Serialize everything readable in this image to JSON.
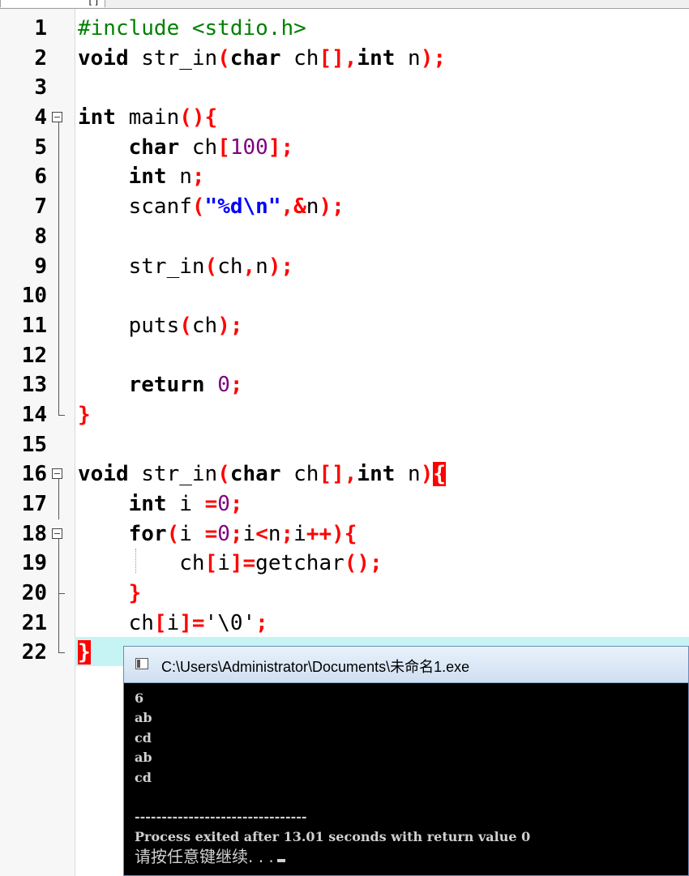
{
  "tab": {
    "label": "[*]"
  },
  "editor": {
    "lines": [
      {
        "n": "1",
        "fold": "none",
        "tokens": [
          [
            "pp",
            "#include <stdio.h>"
          ]
        ]
      },
      {
        "n": "2",
        "fold": "none",
        "tokens": [
          [
            "kw",
            "void"
          ],
          [
            "t",
            " str_in"
          ],
          [
            "p",
            "("
          ],
          [
            "kw",
            "char"
          ],
          [
            "t",
            " ch"
          ],
          [
            "p",
            "[],"
          ],
          [
            "kw",
            "int"
          ],
          [
            "t",
            " n"
          ],
          [
            "p",
            ");"
          ]
        ]
      },
      {
        "n": "3",
        "fold": "none",
        "tokens": []
      },
      {
        "n": "4",
        "fold": "open",
        "tokens": [
          [
            "kw",
            "int"
          ],
          [
            "t",
            " main"
          ],
          [
            "p",
            "(){"
          ]
        ]
      },
      {
        "n": "5",
        "fold": "inner",
        "tokens": [
          [
            "t",
            "    "
          ],
          [
            "kw",
            "char"
          ],
          [
            "t",
            " ch"
          ],
          [
            "p",
            "["
          ],
          [
            "num",
            "100"
          ],
          [
            "p",
            "];"
          ]
        ]
      },
      {
        "n": "6",
        "fold": "inner",
        "tokens": [
          [
            "t",
            "    "
          ],
          [
            "kw",
            "int"
          ],
          [
            "t",
            " n"
          ],
          [
            "p",
            ";"
          ]
        ]
      },
      {
        "n": "7",
        "fold": "inner",
        "tokens": [
          [
            "t",
            "    scanf"
          ],
          [
            "p",
            "("
          ],
          [
            "str",
            "\"%d\\n\""
          ],
          [
            "p",
            ",&"
          ],
          [
            "t",
            "n"
          ],
          [
            "p",
            ");"
          ]
        ]
      },
      {
        "n": "8",
        "fold": "inner",
        "tokens": []
      },
      {
        "n": "9",
        "fold": "inner",
        "tokens": [
          [
            "t",
            "    str_in"
          ],
          [
            "p",
            "("
          ],
          [
            "t",
            "ch"
          ],
          [
            "p",
            ","
          ],
          [
            "t",
            "n"
          ],
          [
            "p",
            ");"
          ]
        ]
      },
      {
        "n": "10",
        "fold": "inner",
        "tokens": []
      },
      {
        "n": "11",
        "fold": "inner",
        "tokens": [
          [
            "t",
            "    puts"
          ],
          [
            "p",
            "("
          ],
          [
            "t",
            "ch"
          ],
          [
            "p",
            ");"
          ]
        ]
      },
      {
        "n": "12",
        "fold": "inner",
        "tokens": []
      },
      {
        "n": "13",
        "fold": "inner",
        "tokens": [
          [
            "t",
            "    "
          ],
          [
            "kw",
            "return"
          ],
          [
            "t",
            " "
          ],
          [
            "num",
            "0"
          ],
          [
            "p",
            ";"
          ]
        ]
      },
      {
        "n": "14",
        "fold": "end",
        "tokens": [
          [
            "p",
            "}"
          ]
        ]
      },
      {
        "n": "15",
        "fold": "none",
        "tokens": []
      },
      {
        "n": "16",
        "fold": "open",
        "tokens": [
          [
            "kw",
            "void"
          ],
          [
            "t",
            " str_in"
          ],
          [
            "p",
            "("
          ],
          [
            "kw",
            "char"
          ],
          [
            "t",
            " ch"
          ],
          [
            "p",
            "[],"
          ],
          [
            "kw",
            "int"
          ],
          [
            "t",
            " n"
          ],
          [
            "p",
            ")"
          ],
          [
            "hl",
            "{"
          ]
        ]
      },
      {
        "n": "17",
        "fold": "inner",
        "tokens": [
          [
            "t",
            "    "
          ],
          [
            "kw",
            "int"
          ],
          [
            "t",
            " i "
          ],
          [
            "p",
            "="
          ],
          [
            "num",
            "0"
          ],
          [
            "p",
            ";"
          ]
        ]
      },
      {
        "n": "18",
        "fold": "open",
        "tokens": [
          [
            "t",
            "    "
          ],
          [
            "kw",
            "for"
          ],
          [
            "p",
            "("
          ],
          [
            "t",
            "i "
          ],
          [
            "p",
            "="
          ],
          [
            "num",
            "0"
          ],
          [
            "p",
            ";"
          ],
          [
            "t",
            "i"
          ],
          [
            "p",
            "<"
          ],
          [
            "t",
            "n"
          ],
          [
            "p",
            ";"
          ],
          [
            "t",
            "i"
          ],
          [
            "p",
            "++){"
          ]
        ]
      },
      {
        "n": "19",
        "fold": "inner",
        "tokens": [
          [
            "t",
            "        ch"
          ],
          [
            "p",
            "["
          ],
          [
            "t",
            "i"
          ],
          [
            "p",
            "]="
          ],
          [
            "t",
            "getchar"
          ],
          [
            "p",
            "();"
          ]
        ]
      },
      {
        "n": "20",
        "fold": "mid",
        "tokens": [
          [
            "t",
            "    "
          ],
          [
            "p",
            "}"
          ]
        ]
      },
      {
        "n": "21",
        "fold": "inner",
        "tokens": [
          [
            "t",
            "    ch"
          ],
          [
            "p",
            "["
          ],
          [
            "t",
            "i"
          ],
          [
            "p",
            "]="
          ],
          [
            "t",
            "'\\0'"
          ],
          [
            "p",
            ";"
          ]
        ]
      },
      {
        "n": "22",
        "fold": "end",
        "tokens": [
          [
            "hl",
            "}"
          ]
        ]
      }
    ]
  },
  "console": {
    "title": "C:\\Users\\Administrator\\Documents\\未命名1.exe",
    "lines": [
      "6",
      "ab",
      "cd",
      "ab",
      "cd",
      "",
      "--------------------------------"
    ],
    "process_line": "Process exited after 13.01 seconds with return value 0",
    "prompt": "请按任意键继续. . ."
  }
}
